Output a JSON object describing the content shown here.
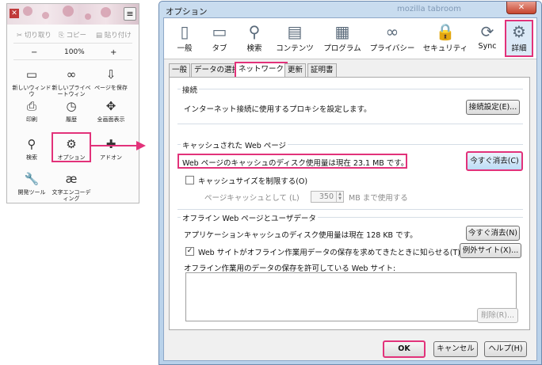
{
  "firefox_menu": {
    "close": "✕",
    "menu_button": "≡",
    "edit": {
      "cut": "切り取り",
      "copy": "コピー",
      "paste": "貼り付け"
    },
    "zoom": {
      "minus": "−",
      "value": "100%",
      "plus": "+"
    },
    "items": [
      {
        "label": "新しいウィンドウ",
        "icon": "window-icon",
        "glyph": "▭"
      },
      {
        "label": "新しいプライベートウィン",
        "icon": "private-mask-icon",
        "glyph": "∞"
      },
      {
        "label": "ページを保存",
        "icon": "save-page-icon",
        "glyph": "⇩"
      },
      {
        "label": "印刷",
        "icon": "print-icon",
        "glyph": "⎙"
      },
      {
        "label": "履歴",
        "icon": "history-clock-icon",
        "glyph": "◷"
      },
      {
        "label": "全画面表示",
        "icon": "fullscreen-icon",
        "glyph": "✥"
      },
      {
        "label": "検索",
        "icon": "search-icon",
        "glyph": "⚲"
      },
      {
        "label": "オプション",
        "icon": "gear-icon",
        "glyph": "⚙"
      },
      {
        "label": "アドオン",
        "icon": "addon-puzzle-icon",
        "glyph": "✚"
      },
      {
        "label": "開発ツール",
        "icon": "wrench-icon",
        "glyph": "🔧"
      },
      {
        "label": "文字エンコーディング",
        "icon": "encoding-icon",
        "glyph": "æ"
      }
    ]
  },
  "options_window": {
    "title": "オプション",
    "ghost_title": "mozilla tabroom",
    "close": "✕",
    "toolbar": [
      {
        "label": "一般",
        "icon": "general-icon",
        "glyph": "▯"
      },
      {
        "label": "タブ",
        "icon": "tabs-icon",
        "glyph": "▭"
      },
      {
        "label": "検索",
        "icon": "search-icon",
        "glyph": "⚲"
      },
      {
        "label": "コンテンツ",
        "icon": "content-icon",
        "glyph": "▤"
      },
      {
        "label": "プログラム",
        "icon": "programs-icon",
        "glyph": "▦"
      },
      {
        "label": "プライバシー",
        "icon": "privacy-mask-icon",
        "glyph": "∞"
      },
      {
        "label": "セキュリティ",
        "icon": "security-lock-icon",
        "glyph": "🔒"
      },
      {
        "label": "Sync",
        "icon": "sync-icon",
        "glyph": "⟳"
      },
      {
        "label": "詳細",
        "icon": "advanced-gear-icon",
        "glyph": "⚙"
      }
    ],
    "subtabs": [
      "一般",
      "データの選択",
      "ネットワーク",
      "更新",
      "証明書"
    ],
    "connection": {
      "title": "接続",
      "text": "インターネット接続に使用するプロキシを設定します。",
      "button": "接続設定(E)..."
    },
    "cache": {
      "title": "キャッシュされた Web ページ",
      "usage_text": "Web ページのキャッシュのディスク使用量は現在 23.1 MB です。",
      "clear_button": "今すぐ消去(C)",
      "limit_label": "キャッシュサイズを制限する(O)",
      "page_cache_label": "ページキャッシュとして (L)",
      "page_cache_value": "350",
      "page_cache_unit": "MB まで使用する"
    },
    "offline": {
      "title": "オフライン Web ページとユーザデータ",
      "usage_text": "アプリケーションキャッシュのディスク使用量は現在 128 KB です。",
      "clear_button": "今すぐ消去(N)",
      "notify_label": "Web サイトがオフライン作業用データの保存を求めてきたときに知らせる(T)",
      "notify_checked": "✓",
      "exceptions_button": "例外サイト(X)...",
      "allowed_label": "オフライン作業用のデータの保存を許可している Web サイト:",
      "remove_button": "削除(R)..."
    },
    "buttons": {
      "ok": "OK",
      "cancel": "キャンセル",
      "help": "ヘルプ(H)"
    }
  }
}
